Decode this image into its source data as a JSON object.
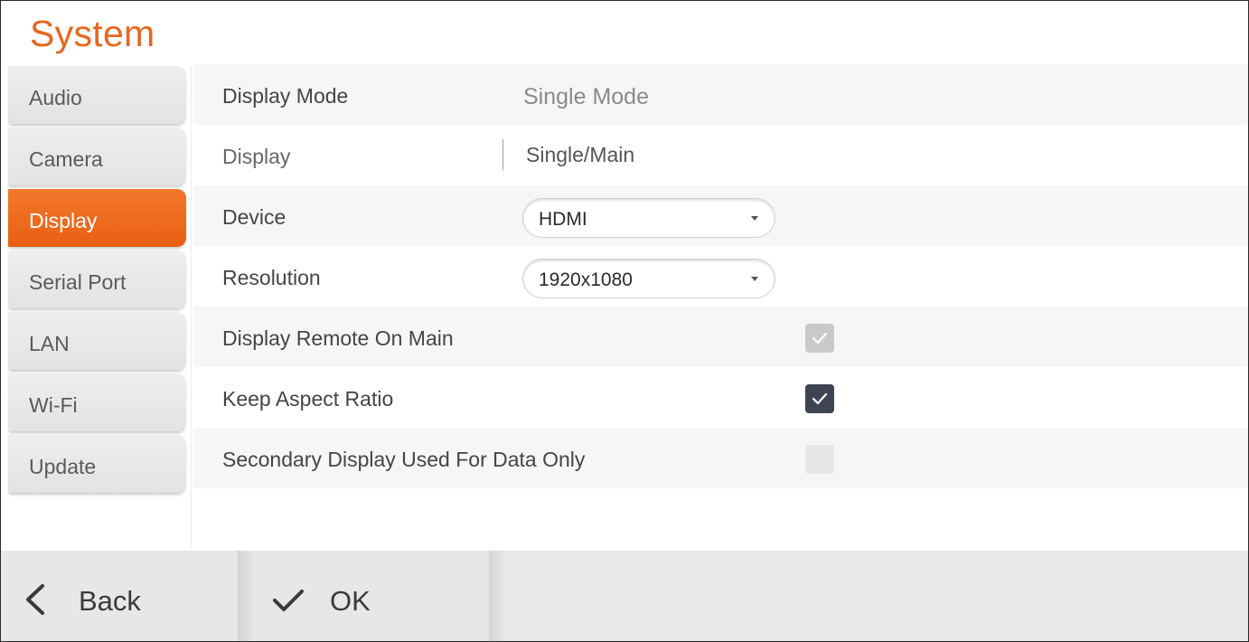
{
  "title": "System",
  "sidebar": {
    "items": [
      {
        "label": "Audio",
        "active": false
      },
      {
        "label": "Camera",
        "active": false
      },
      {
        "label": "Display",
        "active": true
      },
      {
        "label": "Serial Port",
        "active": false
      },
      {
        "label": "LAN",
        "active": false
      },
      {
        "label": "Wi-Fi",
        "active": false
      },
      {
        "label": "Update",
        "active": false
      }
    ]
  },
  "settings": {
    "display_mode": {
      "label": "Display Mode",
      "value": "Single Mode"
    },
    "display": {
      "label": "Display",
      "value": "Single/Main"
    },
    "device": {
      "label": "Device",
      "selected": "HDMI"
    },
    "resolution": {
      "label": "Resolution",
      "selected": "1920x1080"
    },
    "display_remote_on_main": {
      "label": "Display Remote On Main",
      "checked": true,
      "enabled": false
    },
    "keep_aspect_ratio": {
      "label": "Keep Aspect Ratio",
      "checked": true,
      "enabled": true
    },
    "secondary_display_data_only": {
      "label": "Secondary Display Used For Data Only",
      "checked": false,
      "enabled": false
    }
  },
  "footer": {
    "back_label": "Back",
    "back_icon": "chevron-left-icon",
    "ok_label": "OK",
    "ok_icon": "checkmark-icon"
  },
  "colors": {
    "accent": "#e8661f",
    "checkbox_checked": "#3e4452",
    "checkbox_disabled": "#c9c9c9"
  }
}
